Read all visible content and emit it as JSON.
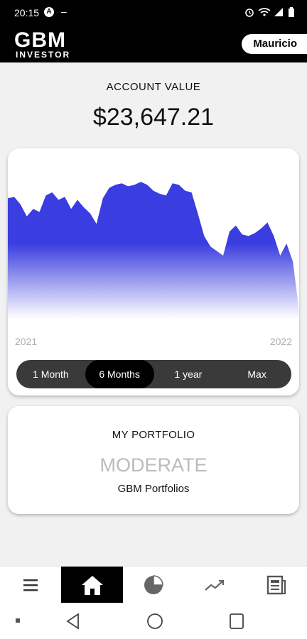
{
  "status_bar": {
    "time": "20:15",
    "badge": "A",
    "dash": "–",
    "icons": [
      "alarm-icon",
      "wifi-icon",
      "signal-icon",
      "battery-icon"
    ]
  },
  "header": {
    "logo_main": "GBM",
    "logo_sub": "INVESTOR",
    "user_name": "Mauricio"
  },
  "account": {
    "label": "ACCOUNT VALUE",
    "value": "$23,647.21"
  },
  "chart_data": {
    "type": "area",
    "x_labels": [
      "2021",
      "2022"
    ],
    "values": [
      0.8,
      0.81,
      0.76,
      0.68,
      0.73,
      0.71,
      0.82,
      0.84,
      0.79,
      0.81,
      0.73,
      0.79,
      0.74,
      0.7,
      0.63,
      0.8,
      0.87,
      0.89,
      0.9,
      0.88,
      0.89,
      0.91,
      0.89,
      0.85,
      0.83,
      0.82,
      0.9,
      0.89,
      0.85,
      0.84,
      0.7,
      0.55,
      0.48,
      0.45,
      0.42,
      0.58,
      0.62,
      0.56,
      0.55,
      0.57,
      0.6,
      0.64,
      0.55,
      0.42,
      0.5,
      0.38,
      0.05
    ],
    "colors": {
      "area_top": "#3a3de0",
      "area_bottom": "#ffffff"
    }
  },
  "range_selector": {
    "options": [
      "1 Month",
      "6 Months",
      "1 year",
      "Max"
    ],
    "active": "6 Months"
  },
  "portfolio": {
    "title": "MY PORTFOLIO",
    "type": "MODERATE",
    "subtitle": "GBM Portfolios"
  },
  "bottom_nav": {
    "items": [
      "menu-icon",
      "home-icon",
      "pie-chart-icon",
      "trend-icon",
      "news-icon"
    ],
    "active": "home-icon"
  },
  "android_nav": [
    "recent-apps-icon",
    "back-icon",
    "home-circle-icon",
    "overview-icon"
  ]
}
